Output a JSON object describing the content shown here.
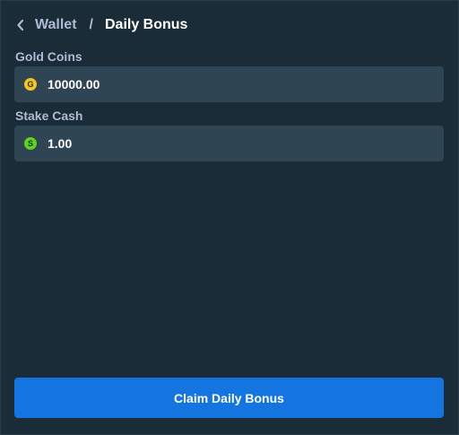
{
  "breadcrumb": {
    "parent": "Wallet",
    "separator": "/",
    "current": "Daily Bonus"
  },
  "fields": [
    {
      "label": "Gold Coins",
      "icon": "gold-coin-icon",
      "icon_glyph": "G",
      "icon_color": "#f5c518",
      "value": "10000.00"
    },
    {
      "label": "Stake Cash",
      "icon": "stake-cash-icon",
      "icon_glyph": "S",
      "icon_color": "#5fd41e",
      "value": "1.00"
    }
  ],
  "claim_button": {
    "label": "Claim Daily Bonus",
    "color": "#1475e1"
  }
}
